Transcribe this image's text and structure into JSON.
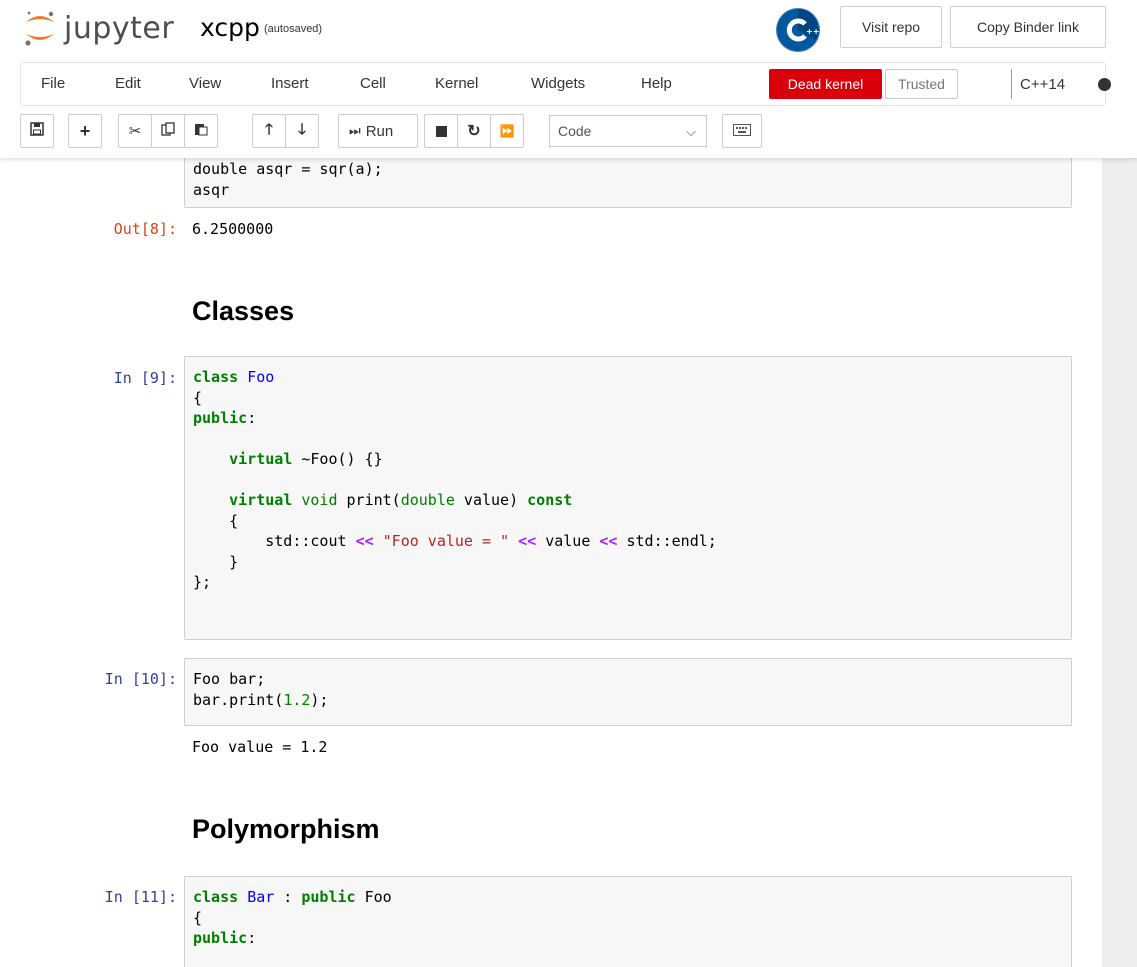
{
  "header": {
    "logo_text": "jupyter",
    "notebook_name": "xcpp",
    "save_status": "(autosaved)",
    "visit_repo": "Visit repo",
    "copy_binder_link": "Copy Binder link"
  },
  "menu": {
    "items": [
      "File",
      "Edit",
      "View",
      "Insert",
      "Cell",
      "Kernel",
      "Widgets",
      "Help"
    ],
    "dead_kernel": "Dead kernel",
    "trusted": "Trusted",
    "kernel_name": "C++14"
  },
  "toolbar": {
    "run_label": "Run",
    "cell_type": "Code"
  },
  "cells": {
    "cell8": {
      "code_lines": [
        "double asqr = sqr(a);",
        "asqr"
      ],
      "out_prompt": "Out[8]:",
      "output": "6.2500000"
    },
    "md_classes": "Classes",
    "cell9": {
      "prompt": "In [9]:"
    },
    "cell10": {
      "prompt": "In [10]:",
      "output": "Foo value = 1.2"
    },
    "md_polymorphism": "Polymorphism",
    "cell11": {
      "prompt": "In [11]:"
    }
  },
  "colors": {
    "dead_kernel_bg": "#d9000c",
    "in_prompt": "#303f9f",
    "out_prompt": "#d84315",
    "keyword": "#008000",
    "class_name": "#0000ff",
    "operator": "#aa22ff",
    "string": "#ba2121"
  }
}
